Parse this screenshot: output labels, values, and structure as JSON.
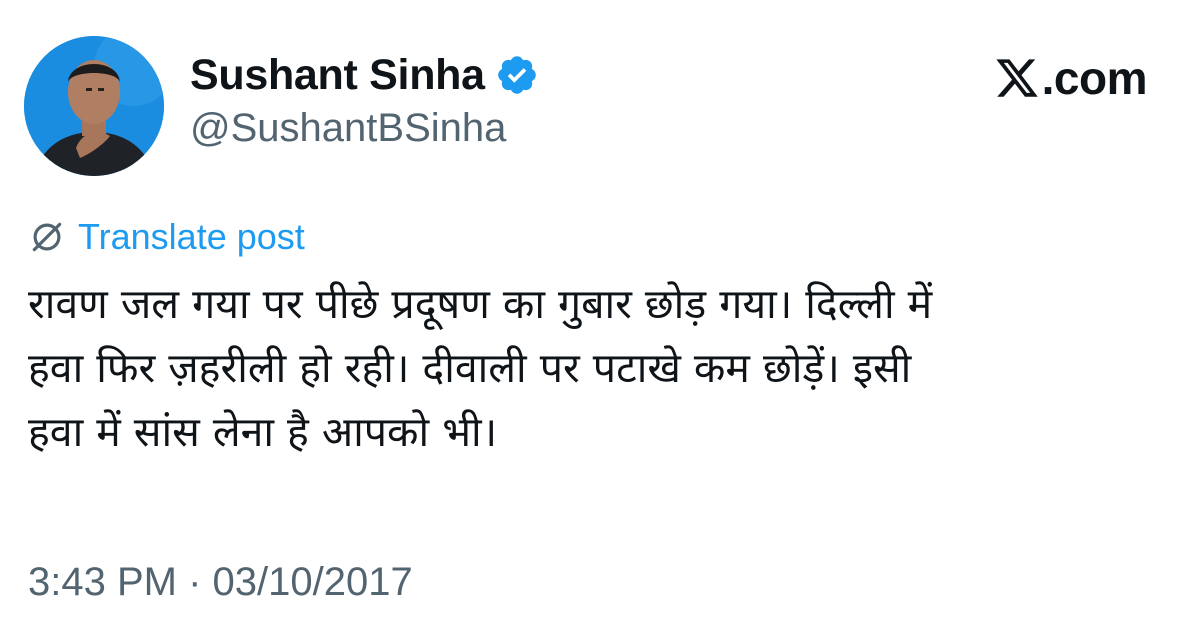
{
  "author": {
    "display_name": "Sushant Sinha",
    "handle": "@SushantBSinha",
    "verified": true
  },
  "brand": {
    "text": ".com",
    "icon": "x-logo-icon"
  },
  "translate": {
    "label": "Translate post",
    "icon": "translate-globe-icon"
  },
  "post": {
    "lines": [
      "रावण जल गया पर पीछे प्रदूषण का गुबार छोड़ गया। दिल्ली में",
      "हवा फिर ज़हरीली हो रही। दीवाली पर पटाखे कम छोड़ें। इसी",
      "हवा में सांस लेना है आपको भी।"
    ]
  },
  "meta": {
    "time": "3:43 PM",
    "separator": "·",
    "date": "03/10/2017"
  },
  "colors": {
    "verified_badge": "#1d9bf0",
    "link": "#1d9bf0",
    "secondary_text": "#536471",
    "primary_text": "#0f1419"
  }
}
